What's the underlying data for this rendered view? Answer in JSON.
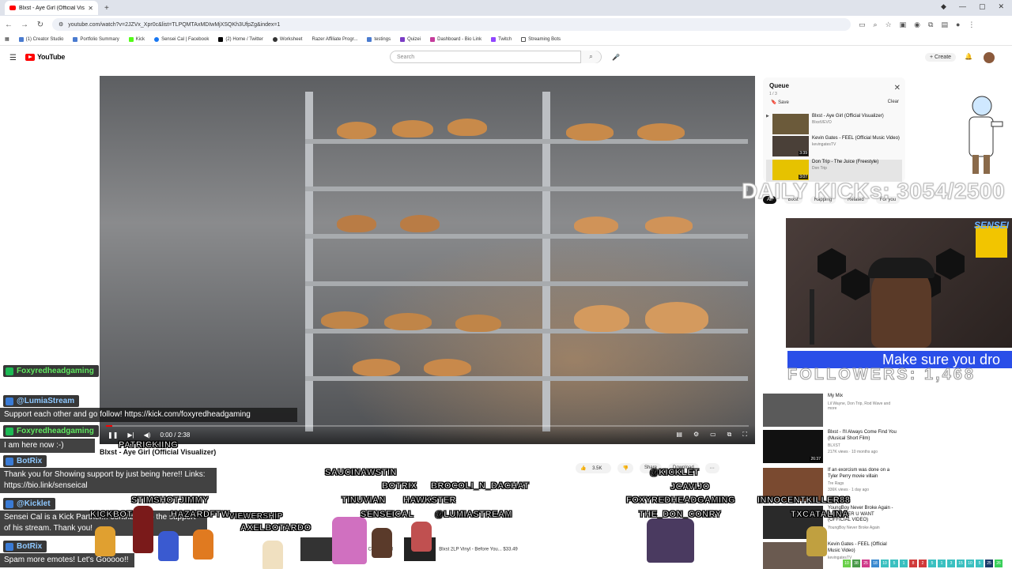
{
  "browser": {
    "tab_title": "Blxst - Aye Girl (Official Vis...",
    "url": "youtube.com/watch?v=2JZVx_Xpr0c&list=TLPQMTAxMDIwMjXSQKh3UfpZg&index=1",
    "bookmarks": [
      "(1) Creator Studio",
      "Portfolio Summary",
      "Kick",
      "Sensei Cal | Facebook",
      "(2) Home / Twitter",
      "Worksheet",
      "Razer Affiliate Progr...",
      "testings",
      "Quizei",
      "Dashboard - Bio Link",
      "Twitch",
      "Streaming Bots"
    ]
  },
  "youtube": {
    "logo": "YouTube",
    "search_placeholder": "Search",
    "create_label": "+ Create",
    "video": {
      "title": "Blxst - Aye Girl (Official Visualizer)",
      "time": "0:00 / 2:38",
      "likes": "3.5K",
      "share": "Share",
      "download": "Download"
    },
    "queue": {
      "title": "Queue",
      "count": "1 / 3",
      "save": "Save",
      "clear": "Clear",
      "items": [
        {
          "title": "Blxst - Aye Girl (Official Visualizer)",
          "channel": "BlxstVEVO",
          "duration": ""
        },
        {
          "title": "Kevin Gates - FEEL (Official Music Video)",
          "channel": "kevingatesTV",
          "duration": "3:39"
        },
        {
          "title": "Don Trip - The Juice (Freestyle)",
          "channel": "Don Trip",
          "duration": "3:07"
        }
      ]
    },
    "chips": [
      "All",
      "Blxst",
      "Rapping",
      "Related",
      "For you"
    ],
    "recommendations": [
      {
        "title": "My Mix",
        "channel": "Lil Wayne, Don Trip, Rod Wave and more",
        "duration": ""
      },
      {
        "title": "Blxst - I'll Always Come Find You (Musical Short Film)",
        "channel": "BLXST",
        "meta": "217K views · 10 months ago",
        "duration": "26:37"
      },
      {
        "title": "If an exorcism was done on a Tyler Perry movie villain",
        "channel": "Tre Rags",
        "meta": "336K views · 1 day ago",
        "duration": ""
      },
      {
        "title": "YoungBoy Never Broke Again - WHATEVER U WANT (OFFICIAL VIDEO)",
        "channel": "YoungBoy Never Broke Again",
        "duration": ""
      },
      {
        "title": "Kevin Gates - FEEL (Official Music Video)",
        "channel": "kevingatesTV",
        "duration": ""
      }
    ],
    "bottom_row": [
      {
        "title": "Blxst - Just For Clarity Vinyl",
        "price": ""
      },
      {
        "title": "Blxst 2LP Vinyl - Before You...",
        "price": "$33.49"
      }
    ]
  },
  "overlay": {
    "daily_kicks": "DAILY KICKs: 3054/2500",
    "ticker": "Make sure you dro",
    "followers": "FOLLOWERS: 1,468",
    "webcam_tag": "SENSEI"
  },
  "chat": [
    {
      "user": "Foxyredheadgaming",
      "badge": "green",
      "message": ""
    },
    {
      "user": "@LumiaStream",
      "badge": "blue",
      "message": "Support each other and go follow! https://kick.com/foxyredheadgaming"
    },
    {
      "user": "Foxyredheadgaming",
      "badge": "green",
      "message": "I am here now :-)"
    },
    {
      "user": "BotRix",
      "badge": "blue",
      "message": "Thank you for Showing support by just being here!! Links: https://bio.link/senseical"
    },
    {
      "user": "@Kicklet",
      "badge": "blue",
      "message": "Sensei Cal is a Kick Partner... contribute to the support of his stream. Thank you!"
    },
    {
      "user": "BotRix",
      "badge": "blue",
      "message": "Spam more emotes! Let's Gooooo!!"
    }
  ],
  "overlay_names": [
    "PATRICKIING",
    "SAUCINAWSTIN",
    "BOTRIX",
    "BROCOLI_N_DACHAT",
    "@KICKLET",
    "TINUVIAN",
    "HAWKSTER",
    "JCAVIJO",
    "STIMSHOTJIMMY",
    "FOXYREDHEADGAMING",
    "INNOCENTKILLER88",
    "KICKBOT",
    "HAZARDFTW",
    "SENSEICAL",
    "@LUMIASTREAM",
    "THE_DON_CONRY",
    "TXCATALINA",
    "AXELBOTARDO",
    "VIEWERSHIP"
  ],
  "colorbar": [
    "10",
    "38",
    "25",
    "18",
    "10",
    "5",
    "1",
    "8",
    "2",
    "5",
    "1",
    "3",
    "15",
    "10",
    "5",
    "25",
    "26"
  ]
}
